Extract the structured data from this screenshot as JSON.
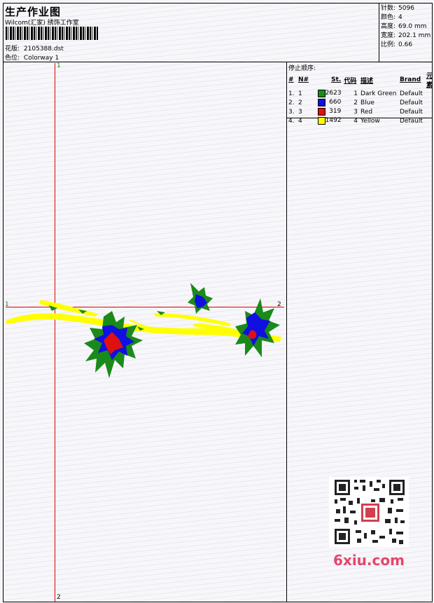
{
  "header": {
    "title": "生产作业图",
    "studio": "Wilcom(汇家) 绣饰工作室",
    "design_label": "花版:",
    "design_file": "2105388.dst",
    "colorway_label": "色位:",
    "colorway": "Colorway 1"
  },
  "stats": [
    {
      "label": "针数:",
      "value": "5096"
    },
    {
      "label": "颜色:",
      "value": "4"
    },
    {
      "label": "高度:",
      "value": "69.0 mm"
    },
    {
      "label": "宽度:",
      "value": "202.1 mm"
    },
    {
      "label": "比例:",
      "value": "0.66"
    }
  ],
  "stop_sequence": {
    "title": "停止顺序:",
    "columns": [
      "#",
      "N#",
      "St.",
      "代码",
      "描述",
      "Brand",
      "元素"
    ],
    "rows": [
      {
        "idx": "1.",
        "n": "1",
        "color": "#1a8a1a",
        "st": "2623",
        "code": "1",
        "desc": "Dark Green",
        "brand": "Default"
      },
      {
        "idx": "2.",
        "n": "2",
        "color": "#1010e0",
        "st": "660",
        "code": "2",
        "desc": "Blue",
        "brand": "Default"
      },
      {
        "idx": "3.",
        "n": "3",
        "color": "#e01010",
        "st": "319",
        "code": "3",
        "desc": "Red",
        "brand": "Default"
      },
      {
        "idx": "4.",
        "n": "4",
        "color": "#ffff00",
        "st": "1492",
        "code": "4",
        "desc": "Yellow",
        "brand": "Default"
      }
    ]
  },
  "axis_markers": {
    "top": "1",
    "left": "1",
    "right": "2",
    "bottom": "2"
  },
  "watermark": "6xiu.com",
  "colors": {
    "crosshair": "#e00000",
    "yellow": "#ffff00",
    "green": "#1a8a1a",
    "blue": "#1010e0",
    "red": "#e01010"
  }
}
